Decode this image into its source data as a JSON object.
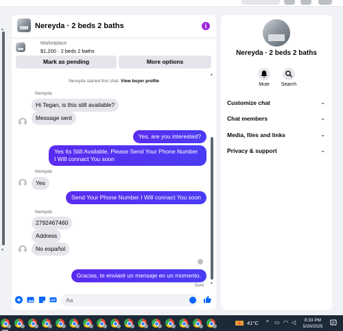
{
  "chat": {
    "title": "Nereyda · 2 beds 2 baths",
    "marketplace_label": "Marketplace",
    "listing_price": "$1,200 · 2 beds 2 baths",
    "mark_pending_label": "Mark as pending",
    "more_options_label": "More options",
    "system_message_prefix": "Nereyda started this chat.",
    "system_message_link": "View buyer profile",
    "sent_label": "Sent",
    "composer_placeholder": "Aa",
    "messages": [
      {
        "sender": "Nereyda",
        "text": "Hi Tegan, is this still available?"
      },
      {
        "text": "Message sent"
      },
      {
        "text": "Yes, are you interested?"
      },
      {
        "text": "Yes Its Still Available, Please Send Your Phone Number I Will connact You soon"
      },
      {
        "sender": "Nereyda",
        "text": "Yes"
      },
      {
        "text": "Send Your Phone Number I Will connact You soon"
      },
      {
        "sender": "Nereyda",
        "text": "2792467460"
      },
      {
        "text": "Address"
      },
      {
        "text": "No español"
      },
      {
        "text": "Gracias, te enviaré un mensaje en un momento."
      }
    ]
  },
  "profile": {
    "name": "Nereyda · 2 beds 2 baths",
    "mute_label": "Mute",
    "search_label": "Search",
    "sections": [
      "Customize chat",
      "Chat members",
      "Media, files and links",
      "Privacy & support"
    ]
  },
  "taskbar": {
    "temperature": "41°C",
    "time": "8:33 PM",
    "date": "5/20/2025"
  },
  "colors": {
    "outgoing_bubble": "#5b2bf0",
    "incoming_bubble": "#e4e6eb",
    "accent": "#0866ff",
    "taskbar": "#1c2a38"
  }
}
